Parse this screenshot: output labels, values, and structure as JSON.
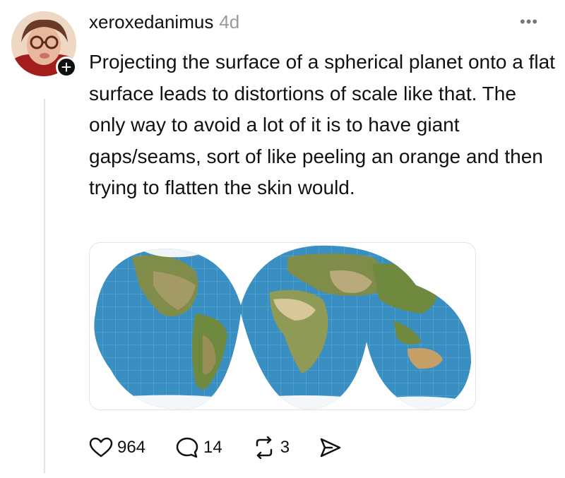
{
  "post": {
    "username": "xeroxedanimus",
    "timestamp": "4d",
    "text": "Projecting the surface of a spherical planet onto a flat surface leads to distortions of scale like that. The only way to avoid a lot of it is to have giant gaps/seams, sort of like peeling an orange and then trying to flatten the skin would.",
    "more_icon": "more-horizontal-icon",
    "follow_icon": "plus-icon",
    "media": {
      "type": "interrupted world map projection",
      "ocean_color": "#3a8fc2",
      "land_color": "#8e9a55"
    }
  },
  "actions": {
    "likes": "964",
    "replies": "14",
    "reposts": "3",
    "icons": [
      "heart-icon",
      "comment-icon",
      "repost-icon",
      "share-icon"
    ]
  }
}
